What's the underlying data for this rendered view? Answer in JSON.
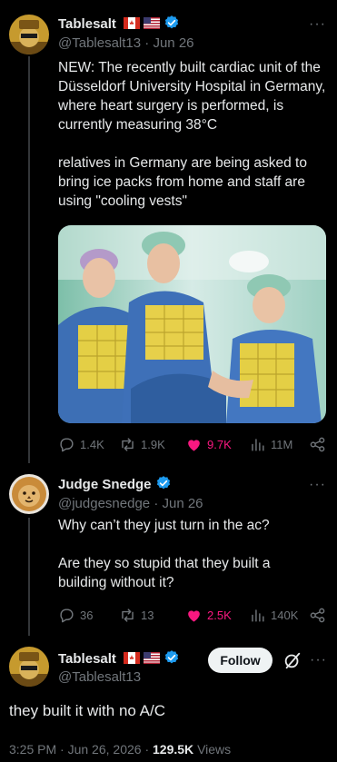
{
  "tweet1": {
    "name": "Tablesalt",
    "handle": "@Tablesalt13",
    "sep": "·",
    "date": "Jun 26",
    "text_p1": "NEW: The recently built cardiac unit of the Düsseldorf University Hospital in Germany, where heart surgery is performed, is currently measuring 38°C",
    "text_p2": "relatives in Germany are being asked to bring ice packs from home and staff are using \"cooling vests\"",
    "replies": "1.4K",
    "reposts": "1.9K",
    "likes": "9.7K",
    "views": "11M"
  },
  "reply": {
    "name": "Judge Snedge",
    "handle": "@judgesnedge",
    "sep": "·",
    "date": "Jun 26",
    "text_p1": "Why can’t they just turn in the ac?",
    "text_p2": "Are they so stupid that they built a building without it?",
    "replies": "36",
    "reposts": "13",
    "likes": "2.5K",
    "views": "140K"
  },
  "main": {
    "name": "Tablesalt",
    "handle": "@Tablesalt13",
    "follow_label": "Follow",
    "text": "they built it with no A/C",
    "time": "3:25 PM",
    "date": "Jun 26, 2026",
    "dot": "·",
    "views_count": "129.5K",
    "views_label": "Views"
  },
  "colors": {
    "background": "#000000",
    "text": "#e7e9ea",
    "muted": "#71767b",
    "verified": "#1d9bf0",
    "like": "#f91880"
  }
}
